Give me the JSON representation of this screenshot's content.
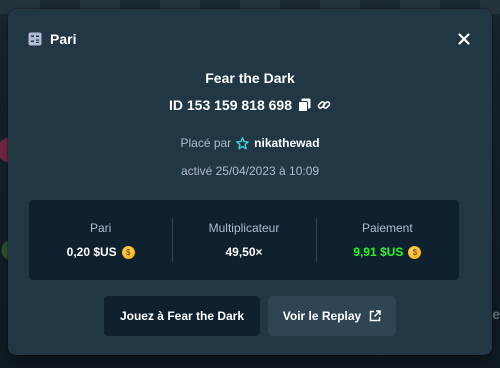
{
  "background": {
    "side_text": "Je"
  },
  "modal": {
    "title": "Pari",
    "game_name": "Fear the Dark",
    "bet_id": "ID 153 159 818 698",
    "placed_by_label": "Placé par",
    "username": "nikathewad",
    "activated": "activé 25/04/2023 à 10:09"
  },
  "stats": {
    "bet_label": "Pari",
    "bet_value": "0,20 $US",
    "multiplier_label": "Multiplicateur",
    "multiplier_value": "49,50×",
    "payout_label": "Paiement",
    "payout_value": "9,91 $US"
  },
  "buttons": {
    "play": "Jouez à Fear the Dark",
    "replay": "Voir le Replay"
  },
  "colors": {
    "modal_bg": "#213743",
    "panel_bg": "#0f212e",
    "muted_text": "#b1bad3",
    "payout_green": "#1fff20",
    "button_grey": "#2f4553"
  },
  "icons": {
    "header": "betslip-icon",
    "close": "close-icon",
    "copy": "copy-icon",
    "link": "link-icon",
    "user": "vip-star-icon",
    "coin": "usd-coin-icon",
    "external": "external-link-icon"
  }
}
